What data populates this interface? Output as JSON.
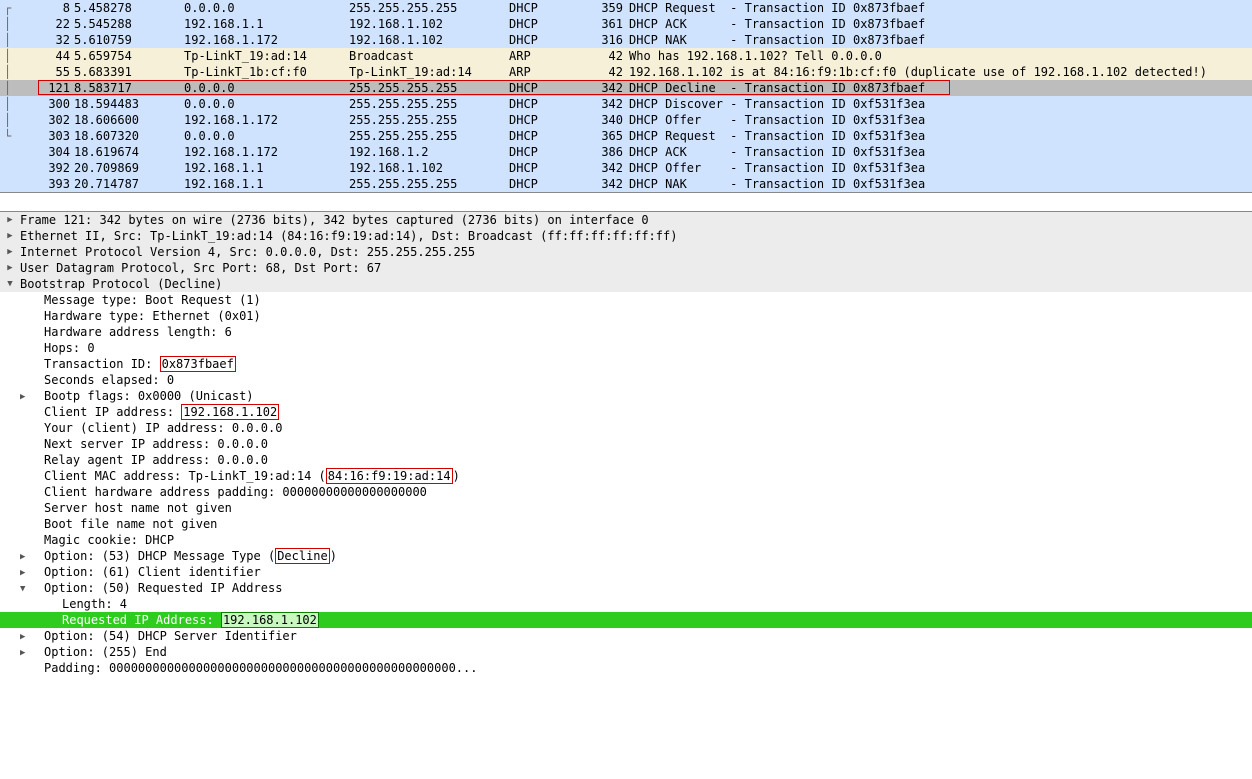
{
  "packets": [
    {
      "tree": "┌",
      "num": "8",
      "time": "5.458278",
      "src": "0.0.0.0",
      "dst": "255.255.255.255",
      "proto": "DHCP",
      "len": "359",
      "info": "DHCP Request  - Transaction ID 0x873fbaef",
      "bg": "bg-lightblue"
    },
    {
      "tree": "│",
      "num": "22",
      "time": "5.545288",
      "src": "192.168.1.1",
      "dst": "192.168.1.102",
      "proto": "DHCP",
      "len": "361",
      "info": "DHCP ACK      - Transaction ID 0x873fbaef",
      "bg": "bg-lightblue"
    },
    {
      "tree": "│",
      "num": "32",
      "time": "5.610759",
      "src": "192.168.1.172",
      "dst": "192.168.1.102",
      "proto": "DHCP",
      "len": "316",
      "info": "DHCP NAK      - Transaction ID 0x873fbaef",
      "bg": "bg-lightblue"
    },
    {
      "tree": "│",
      "num": "44",
      "time": "5.659754",
      "src": "Tp-LinkT_19:ad:14",
      "dst": "Broadcast",
      "proto": "ARP",
      "len": "42",
      "info": "Who has 192.168.1.102? Tell 0.0.0.0",
      "bg": "bg-cream"
    },
    {
      "tree": "│",
      "num": "55",
      "time": "5.683391",
      "src": "Tp-LinkT_1b:cf:f0",
      "dst": "Tp-LinkT_19:ad:14",
      "proto": "ARP",
      "len": "42",
      "info": "192.168.1.102 is at 84:16:f9:1b:cf:f0 (duplicate use of 192.168.1.102 detected!)",
      "bg": "bg-cream"
    },
    {
      "tree": "│",
      "num": "121",
      "time": "8.583717",
      "src": "0.0.0.0",
      "dst": "255.255.255.255",
      "proto": "DHCP",
      "len": "342",
      "info": "DHCP Decline  - Transaction ID 0x873fbaef",
      "bg": "bg-selected",
      "boxed": true
    },
    {
      "tree": "│",
      "num": "300",
      "time": "18.594483",
      "src": "0.0.0.0",
      "dst": "255.255.255.255",
      "proto": "DHCP",
      "len": "342",
      "info": "DHCP Discover - Transaction ID 0xf531f3ea",
      "bg": "bg-lightblue"
    },
    {
      "tree": "│",
      "num": "302",
      "time": "18.606600",
      "src": "192.168.1.172",
      "dst": "255.255.255.255",
      "proto": "DHCP",
      "len": "340",
      "info": "DHCP Offer    - Transaction ID 0xf531f3ea",
      "bg": "bg-lightblue"
    },
    {
      "tree": "└",
      "num": "303",
      "time": "18.607320",
      "src": "0.0.0.0",
      "dst": "255.255.255.255",
      "proto": "DHCP",
      "len": "365",
      "info": "DHCP Request  - Transaction ID 0xf531f3ea",
      "bg": "bg-lightblue"
    },
    {
      "tree": " ",
      "num": "304",
      "time": "18.619674",
      "src": "192.168.1.172",
      "dst": "192.168.1.2",
      "proto": "DHCP",
      "len": "386",
      "info": "DHCP ACK      - Transaction ID 0xf531f3ea",
      "bg": "bg-lightblue"
    },
    {
      "tree": " ",
      "num": "392",
      "time": "20.709869",
      "src": "192.168.1.1",
      "dst": "192.168.1.102",
      "proto": "DHCP",
      "len": "342",
      "info": "DHCP Offer    - Transaction ID 0xf531f3ea",
      "bg": "bg-lightblue"
    },
    {
      "tree": " ",
      "num": "393",
      "time": "20.714787",
      "src": "192.168.1.1",
      "dst": "255.255.255.255",
      "proto": "DHCP",
      "len": "342",
      "info": "DHCP NAK      - Transaction ID 0xf531f3ea",
      "bg": "bg-lightblue"
    }
  ],
  "detail": {
    "hdr_frame": "Frame 121: 342 bytes on wire (2736 bits), 342 bytes captured (2736 bits) on interface 0",
    "hdr_eth": "Ethernet II, Src: Tp-LinkT_19:ad:14 (84:16:f9:19:ad:14), Dst: Broadcast (ff:ff:ff:ff:ff:ff)",
    "hdr_ip": "Internet Protocol Version 4, Src: 0.0.0.0, Dst: 255.255.255.255",
    "hdr_udp": "User Datagram Protocol, Src Port: 68, Dst Port: 67",
    "hdr_bootp": "Bootstrap Protocol (Decline)",
    "msg_type": "Message type: Boot Request (1)",
    "hw_type": "Hardware type: Ethernet (0x01)",
    "hw_len": "Hardware address length: 6",
    "hops": "Hops: 0",
    "tid_label": "Transaction ID: ",
    "tid_value": "0x873fbaef",
    "secs": "Seconds elapsed: 0",
    "flags": "Bootp flags: 0x0000 (Unicast)",
    "cip_label": "Client IP address: ",
    "cip_value": "192.168.1.102",
    "yip": "Your (client) IP address: 0.0.0.0",
    "nsip": "Next server IP address: 0.0.0.0",
    "rip": "Relay agent IP address: 0.0.0.0",
    "mac_label": "Client MAC address: Tp-LinkT_19:ad:14 (",
    "mac_value": "84:16:f9:19:ad:14",
    "mac_close": ")",
    "chpad": "Client hardware address padding: 00000000000000000000",
    "sname": "Server host name not given",
    "bfile": "Boot file name not given",
    "cookie": "Magic cookie: DHCP",
    "opt53_l": "Option: (53) DHCP Message Type (",
    "opt53_v": "Decline",
    "opt53_c": ")",
    "opt61": "Option: (61) Client identifier",
    "opt50": "Option: (50) Requested IP Address",
    "opt50_len": "Length: 4",
    "opt50_rip_l": "Requested IP Address: ",
    "opt50_rip_v": "192.168.1.102",
    "opt54": "Option: (54) DHCP Server Identifier",
    "opt255": "Option: (255) End",
    "padding": "Padding: 000000000000000000000000000000000000000000000000..."
  }
}
